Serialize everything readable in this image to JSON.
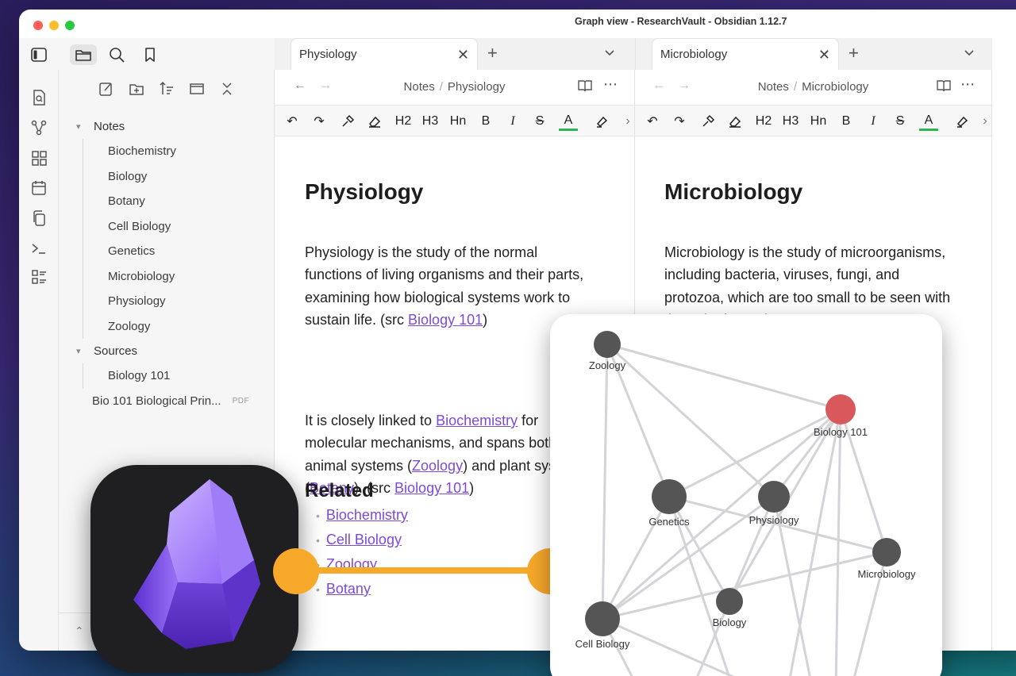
{
  "window": {
    "title": "Graph view - ResearchVault - Obsidian 1.12.7"
  },
  "colors": {
    "accent": "#7c4ad6",
    "link": "#7c4ad6",
    "connector": "#f7a92a",
    "highlight_node": "#d9585c",
    "node": "#555555"
  },
  "sidebar_icons": [
    "sidebar-toggle-icon",
    "folder-icon",
    "search-icon",
    "bookmark-icon"
  ],
  "ribbon_icons": [
    "quick-switcher-icon",
    "graph-icon",
    "canvas-icon",
    "calendar-icon",
    "copy-icon",
    "terminal-icon",
    "templates-icon"
  ],
  "explorer": {
    "tools": [
      "new-note-icon",
      "new-folder-icon",
      "sort-icon",
      "collapse-view-icon",
      "collapse-all-icon"
    ],
    "folders": [
      {
        "name": "Notes",
        "items": [
          "Biochemistry",
          "Biology",
          "Botany",
          "Cell Biology",
          "Genetics",
          "Microbiology",
          "Physiology",
          "Zoology"
        ]
      },
      {
        "name": "Sources",
        "items": [
          "Biology 101"
        ]
      }
    ],
    "files": [
      {
        "name": "Bio 101 Biological Prin...",
        "badge": "PDF"
      }
    ]
  },
  "tabs": [
    {
      "label": "Physiology"
    },
    {
      "label": "Microbiology"
    }
  ],
  "panes": [
    {
      "breadcrumb": {
        "folder": "Notes",
        "separator": "/",
        "note": "Physiology"
      },
      "title": "Physiology",
      "paragraph1": {
        "text": "Physiology is the study of the normal functions of living organisms and their parts, examining how biological systems work to sustain life. (src ",
        "link": "Biology 101",
        "end": ")"
      },
      "paragraph2": {
        "t1": "It is closely linked to ",
        "l1": "Biochemistry",
        "t2": " for molecular mechanisms, and spans both animal systems (",
        "l2": "Zoology",
        "t3": ") and plant systems (",
        "l3": "Botany",
        "t4": "). (src ",
        "l4": "Biology 101",
        "t5": ")"
      },
      "related_heading": "Related",
      "related": [
        "Biochemistry",
        "Cell Biology",
        "Zoology",
        "Botany"
      ]
    },
    {
      "breadcrumb": {
        "folder": "Notes",
        "separator": "/",
        "note": "Microbiology"
      },
      "title": "Microbiology",
      "paragraph1": {
        "text": "Microbiology is the study of microorganisms, including bacteria, viruses, fungi, and protozoa, which are too small to be seen with the naked eye. (src"
      }
    }
  ],
  "toolbar": [
    "undo",
    "redo",
    "format-painter",
    "eraser",
    "H2",
    "H3",
    "Hn",
    "B",
    "I",
    "S",
    "A",
    "highlighter"
  ],
  "graph": {
    "nodes": [
      {
        "label": "Zoology",
        "highlight": false
      },
      {
        "label": "Biology 101",
        "highlight": true
      },
      {
        "label": "Genetics",
        "highlight": false
      },
      {
        "label": "Physiology",
        "highlight": false
      },
      {
        "label": "Microbiology",
        "highlight": false
      },
      {
        "label": "Biology",
        "highlight": false
      },
      {
        "label": "Cell Biology",
        "highlight": false
      }
    ]
  }
}
